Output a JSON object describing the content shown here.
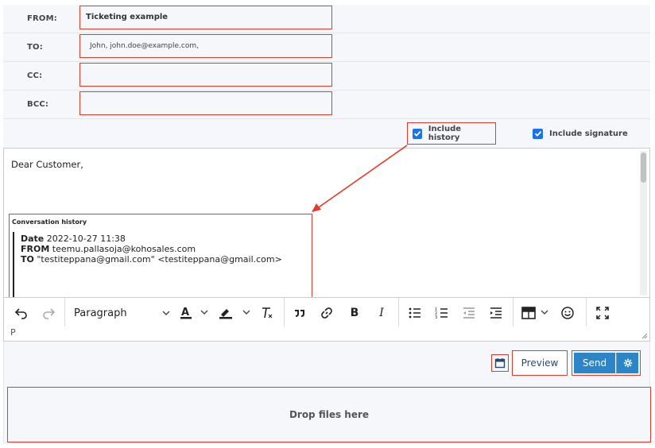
{
  "header_fields": [
    {
      "label": "FROM:",
      "value": "Ticketing example"
    },
    {
      "label": "TO:",
      "value": "John, john.doe@example.com,"
    },
    {
      "label": "CC:",
      "value": ""
    },
    {
      "label": "BCC:",
      "value": ""
    }
  ],
  "options": {
    "include_history": "Include history",
    "include_signature": "Include signature"
  },
  "editor": {
    "greeting": "Dear Customer,",
    "history": {
      "title": "Conversation history",
      "lines": [
        {
          "key": "Date",
          "value": "2022-10-27 11:38"
        },
        {
          "key": "FROM",
          "value": "teemu.pallasoja@kohosales.com"
        },
        {
          "key": "TO",
          "value": "\"testiteppana@gmail.com\" <testiteppana@gmail.com>"
        }
      ]
    }
  },
  "toolbar": {
    "block_format": "Paragraph"
  },
  "statusbar": {
    "path": "P"
  },
  "actions": {
    "preview": "Preview",
    "send": "Send"
  },
  "dropzone": {
    "label": "Drop files here"
  },
  "colors": {
    "highlight": "#e53b2c",
    "primary": "#2b85c7",
    "checkbox": "#1a73e8"
  }
}
